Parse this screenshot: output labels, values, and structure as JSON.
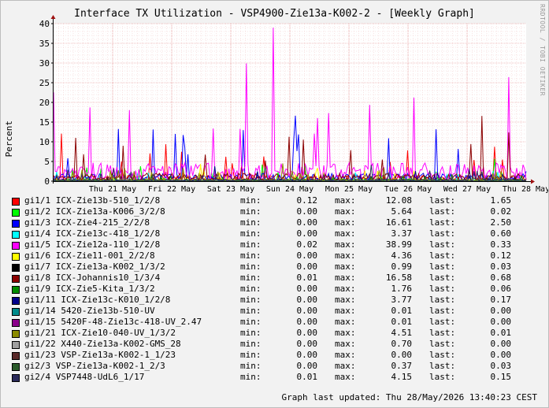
{
  "chart_data": {
    "type": "line",
    "title": "Interface TX Utilization - VSP4900-Zie13a-K002-2 - [Weekly Graph]",
    "ylabel": "Percent",
    "ylim": [
      0,
      40
    ],
    "yticks": [
      0,
      5,
      10,
      15,
      20,
      25,
      30,
      35,
      40
    ],
    "xticks": [
      "Thu 21 May",
      "Fri 22 May",
      "Sat 23 May",
      "Sun 24 May",
      "Mon 25 May",
      "Tue 26 May",
      "Wed 27 May",
      "Thu 28 May"
    ],
    "grid": true,
    "legend_position": "bottom",
    "watermark": "RRDTOOL / TOBI OETIKER",
    "series": [
      {
        "name": "gi1/1 ICX-Zie13b-510_1/2/8",
        "color": "#ff0000",
        "min": "0.12",
        "max": "12.08",
        "last": "1.65"
      },
      {
        "name": "gi1/2 ICX-Zie13a-K006_3/2/8",
        "color": "#00ff00",
        "min": "0.00",
        "max": "5.64",
        "last": "0.02"
      },
      {
        "name": "gi1/3 ICX-Zie4-215_2/2/8",
        "color": "#0000ff",
        "min": "0.00",
        "max": "16.61",
        "last": "2.50"
      },
      {
        "name": "gi1/4 ICX-Zie13c-418_1/2/8",
        "color": "#00ffff",
        "min": "0.00",
        "max": "3.37",
        "last": "0.60"
      },
      {
        "name": "gi1/5 ICX-Zie12a-110_1/2/8",
        "color": "#ff00ff",
        "min": "0.02",
        "max": "38.99",
        "last": "0.33"
      },
      {
        "name": "gi1/6 ICX-Zie11-001_2/2/8",
        "color": "#ffff00",
        "min": "0.00",
        "max": "4.36",
        "last": "0.12"
      },
      {
        "name": "gi1/7 ICX-Zie13a-K002_1/3/2",
        "color": "#000000",
        "min": "0.00",
        "max": "0.99",
        "last": "0.03"
      },
      {
        "name": "gi1/8 ICX-Johannis10_1/3/4",
        "color": "#8b0000",
        "min": "0.01",
        "max": "16.58",
        "last": "0.68"
      },
      {
        "name": "gi1/9 ICX-Zie5-Kita_1/3/2",
        "color": "#008b00",
        "min": "0.00",
        "max": "1.76",
        "last": "0.06"
      },
      {
        "name": "gi1/11 ICX-Zie13c-K010_1/2/8",
        "color": "#00008b",
        "min": "0.00",
        "max": "3.77",
        "last": "0.17"
      },
      {
        "name": "gi1/14 5420-Zie13b-510-UV",
        "color": "#008b8b",
        "min": "0.00",
        "max": "0.01",
        "last": "0.00"
      },
      {
        "name": "gi1/15 5420F-48-Zie13c-418-UV_2.47",
        "color": "#8b008b",
        "min": "0.00",
        "max": "0.01",
        "last": "0.00"
      },
      {
        "name": "gi1/21 ICX-Zie10-040-UV_1/3/2",
        "color": "#8b8b00",
        "min": "0.00",
        "max": "4.51",
        "last": "0.01"
      },
      {
        "name": "gi1/22 X440-Zie13a-K002-GMS_28",
        "color": "#a0a0a0",
        "min": "0.00",
        "max": "0.70",
        "last": "0.00"
      },
      {
        "name": "gi1/23 VSP-Zie13a-K002-1_1/23",
        "color": "#5a2a2a",
        "min": "0.00",
        "max": "0.00",
        "last": "0.00"
      },
      {
        "name": "gi2/3 VSP-Zie13a-K002-1_2/3",
        "color": "#2a5a2a",
        "min": "0.00",
        "max": "0.37",
        "last": "0.03"
      },
      {
        "name": "gi2/4 VSP7448-UdL6_1/17",
        "color": "#2a2a5a",
        "min": "0.01",
        "max": "4.15",
        "last": "0.15"
      }
    ]
  },
  "labels": {
    "min": "min:",
    "max": "max:",
    "last": "last:"
  },
  "footer": {
    "updated": "Graph last updated: Thu 28/May/2026 13:40:23 CEST"
  }
}
